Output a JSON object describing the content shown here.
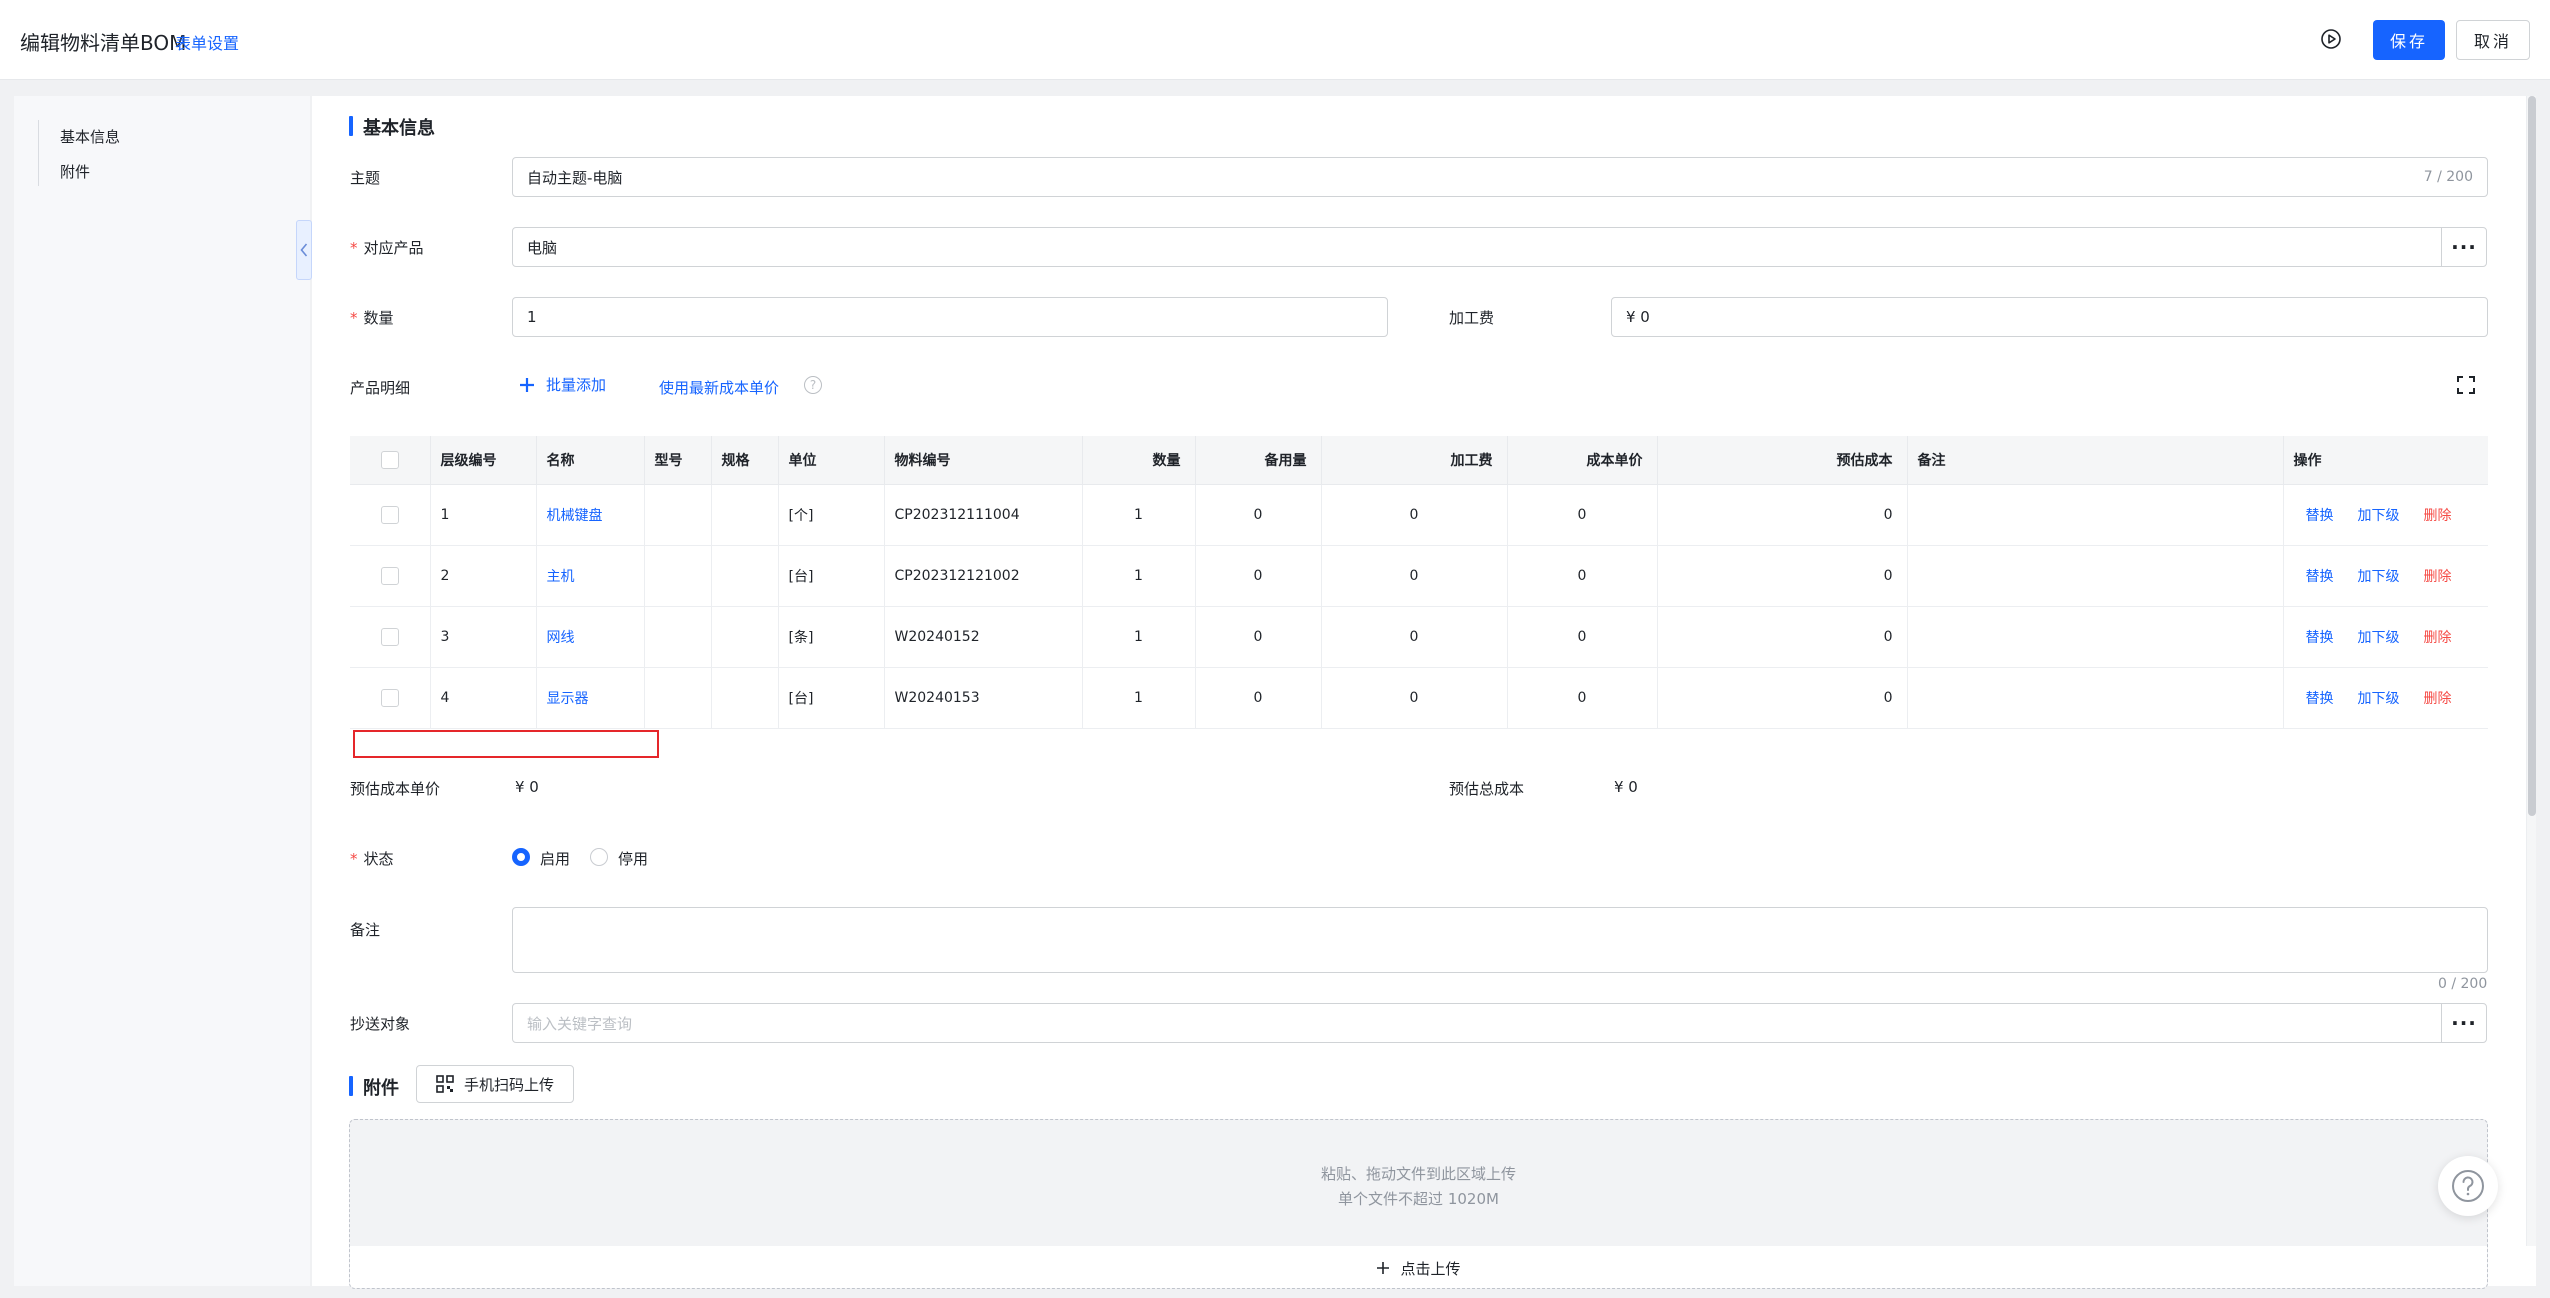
{
  "header": {
    "title": "编辑物料清单BOM",
    "form_settings": "表单设置",
    "save_label": "保存",
    "cancel_label": "取消",
    "play_icon": "play-circle-icon"
  },
  "sidebar": {
    "items": [
      {
        "label": "基本信息"
      },
      {
        "label": "附件"
      }
    ]
  },
  "basic_info": {
    "section_title": "基本信息",
    "subject": {
      "label": "主题",
      "value": "自动主题-电脑",
      "count": "7 / 200"
    },
    "product": {
      "label": "对应产品",
      "value": "电脑",
      "more": "···"
    },
    "quantity": {
      "label": "数量",
      "value": "1"
    },
    "processing_fee": {
      "label": "加工费",
      "value": "¥  0"
    },
    "details": {
      "label": "产品明细",
      "batch_add": "批量添加",
      "use_latest_cost": "使用最新成本单价",
      "help": "?"
    }
  },
  "table": {
    "columns": [
      "层级编号",
      "名称",
      "型号",
      "规格",
      "单位",
      "物料编号",
      "数量",
      "备用量",
      "加工费",
      "成本单价",
      "预估成本",
      "备注",
      "操作"
    ],
    "rows": [
      {
        "level": "1",
        "name": "机械键盘",
        "model": "",
        "spec": "",
        "unit": "[个]",
        "code": "CP202312111004",
        "qty": "1",
        "spare": "0",
        "fee": "0",
        "unit_cost": "0",
        "est_cost": "0",
        "note": ""
      },
      {
        "level": "2",
        "name": "主机",
        "model": "",
        "spec": "",
        "unit": "[台]",
        "code": "CP202312121002",
        "qty": "1",
        "spare": "0",
        "fee": "0",
        "unit_cost": "0",
        "est_cost": "0",
        "note": ""
      },
      {
        "level": "3",
        "name": "网线",
        "model": "",
        "spec": "",
        "unit": "[条]",
        "code": "W20240152",
        "qty": "1",
        "spare": "0",
        "fee": "0",
        "unit_cost": "0",
        "est_cost": "0",
        "note": ""
      },
      {
        "level": "4",
        "name": "显示器",
        "model": "",
        "spec": "",
        "unit": "[台]",
        "code": "W20240153",
        "qty": "1",
        "spare": "0",
        "fee": "0",
        "unit_cost": "0",
        "est_cost": "0",
        "note": ""
      }
    ],
    "actions": {
      "replace": "替换",
      "add_child": "加下级",
      "delete": "删除"
    }
  },
  "summary": {
    "est_unit_cost_label": "预估成本单价",
    "est_unit_cost_value": "¥  0",
    "est_total_cost_label": "预估总成本",
    "est_total_cost_value": "¥  0"
  },
  "status": {
    "label": "状态",
    "options": [
      {
        "label": "启用",
        "selected": true
      },
      {
        "label": "停用",
        "selected": false
      }
    ]
  },
  "remarks": {
    "label": "备注",
    "value": "",
    "count": "0 / 200"
  },
  "cc": {
    "label": "抄送对象",
    "placeholder": "输入关键字查询",
    "more": "···"
  },
  "attachments": {
    "section_title": "附件",
    "scan_upload": "手机扫码上传",
    "drop_hint": "粘贴、拖动文件到此区域上传",
    "size_hint": "单个文件不超过 1020M",
    "click_upload": "点击上传"
  },
  "colors": {
    "accent": "#1664ff",
    "danger": "#f54a45",
    "highlight_box": "#e5262a"
  }
}
